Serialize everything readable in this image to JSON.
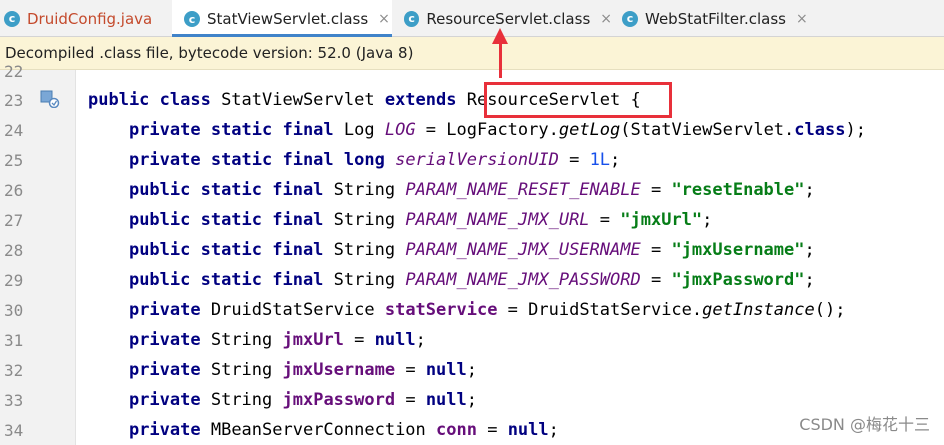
{
  "tabs": [
    {
      "label": "DruidConfig.java",
      "icon": "java-class-icon",
      "closable": false
    },
    {
      "label": "StatViewServlet.class",
      "icon": "class-file-icon",
      "closable": true,
      "active": true
    },
    {
      "label": "ResourceServlet.class",
      "icon": "class-file-icon",
      "closable": true
    },
    {
      "label": "WebStatFilter.class",
      "icon": "class-file-icon",
      "closable": true
    }
  ],
  "close_glyph": "×",
  "banner": {
    "text": "Decompiled .class file, bytecode version: 52.0 (Java 8)"
  },
  "editor": {
    "line_numbers": [
      "22",
      "23",
      "24",
      "25",
      "26",
      "27",
      "28",
      "29",
      "30",
      "31",
      "32",
      "33",
      "34"
    ]
  },
  "annotation": {
    "highlighted_text": "ResourceServlet",
    "color": "#e8303a"
  },
  "watermark": "CSDN @梅花十三",
  "colors": {
    "keyword": "#000080",
    "string": "#067d17",
    "field": "#660e7a",
    "number": "#1750eb",
    "active_tab_underline": "#4083c9",
    "banner_bg": "#fbf4d6"
  }
}
